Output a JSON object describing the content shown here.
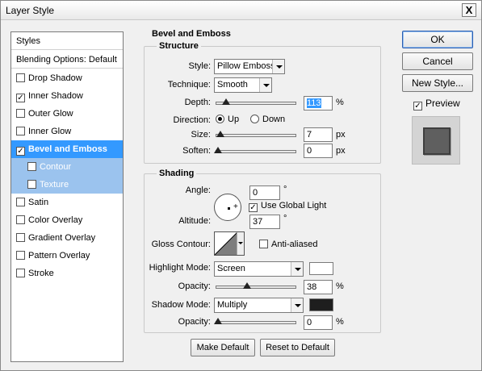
{
  "window": {
    "title": "Layer Style",
    "close_glyph": "X"
  },
  "stylelist": {
    "header": "Styles",
    "blending": "Blending Options: Default",
    "items": [
      {
        "label": "Drop Shadow",
        "checked": false
      },
      {
        "label": "Inner Shadow",
        "checked": true
      },
      {
        "label": "Outer Glow",
        "checked": false
      },
      {
        "label": "Inner Glow",
        "checked": false
      },
      {
        "label": "Bevel and Emboss",
        "checked": true,
        "selected": true
      },
      {
        "label": "Contour",
        "checked": false,
        "sub": true
      },
      {
        "label": "Texture",
        "checked": false,
        "sub": true
      },
      {
        "label": "Satin",
        "checked": false
      },
      {
        "label": "Color Overlay",
        "checked": false
      },
      {
        "label": "Gradient Overlay",
        "checked": false
      },
      {
        "label": "Pattern Overlay",
        "checked": false
      },
      {
        "label": "Stroke",
        "checked": false
      }
    ]
  },
  "bevel": {
    "title": "Bevel and Emboss",
    "structure": {
      "legend": "Structure",
      "style_label": "Style:",
      "style_value": "Pillow Emboss",
      "technique_label": "Technique:",
      "technique_value": "Smooth",
      "depth_label": "Depth:",
      "depth_value": "113",
      "depth_unit": "%",
      "direction_label": "Direction:",
      "direction_up": "Up",
      "direction_down": "Down",
      "size_label": "Size:",
      "size_value": "7",
      "size_unit": "px",
      "soften_label": "Soften:",
      "soften_value": "0",
      "soften_unit": "px"
    },
    "shading": {
      "legend": "Shading",
      "angle_label": "Angle:",
      "angle_value": "0",
      "angle_unit": "°",
      "global_light": "Use Global Light",
      "altitude_label": "Altitude:",
      "altitude_value": "37",
      "altitude_unit": "°",
      "gloss_label": "Gloss Contour:",
      "anti_aliased": "Anti-aliased",
      "highlight_label": "Highlight Mode:",
      "highlight_value": "Screen",
      "highlight_color": "#ffffff",
      "hl_opacity_label": "Opacity:",
      "hl_opacity_value": "38",
      "hl_opacity_unit": "%",
      "shadow_label": "Shadow Mode:",
      "shadow_value": "Multiply",
      "shadow_color": "#1e1e1e",
      "sh_opacity_label": "Opacity:",
      "sh_opacity_value": "0",
      "sh_opacity_unit": "%"
    },
    "make_default": "Make Default",
    "reset_default": "Reset to Default"
  },
  "actions": {
    "ok": "OK",
    "cancel": "Cancel",
    "new_style": "New Style...",
    "preview": "Preview",
    "preview_checked": true
  }
}
